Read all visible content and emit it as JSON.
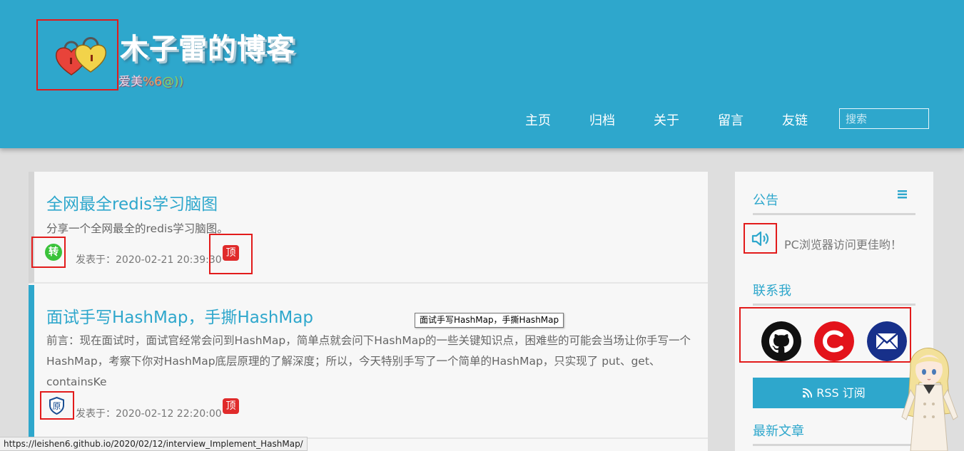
{
  "header": {
    "title": "木子雷的博客",
    "subtitle_part1": "爱美",
    "subtitle_part2": "%6",
    "subtitle_part3": "@))",
    "logo_icon": "heart-locks-icon",
    "nav": [
      {
        "label": "主页"
      },
      {
        "label": "归档"
      },
      {
        "label": "关于"
      },
      {
        "label": "留言"
      },
      {
        "label": "友链"
      }
    ],
    "search_placeholder": "搜索",
    "bg_color": "#2ea7cc"
  },
  "posts": [
    {
      "title": "全网最全redis学习脑图",
      "excerpt": "分享一个全网最全的redis学习脑图。",
      "type_badge": "转",
      "date": "发表于：2020-02-21 20:39:30",
      "top_badge": "顶"
    },
    {
      "title": "面试手写HashMap，手撕HashMap",
      "excerpt": "前言：现在面试时，面试官经常会问到HashMap，简单点就会问下HashMap的一些关键知识点，困难些的可能会当场让你手写一个HashMap，考察下你对HashMap底层原理的了解深度；所以，今天特别手写了一个简单的HashMap，只实现了 put、get、containsKe",
      "type_badge": "原",
      "date": "发表于：2020-02-12 22:20:00",
      "top_badge": "顶"
    }
  ],
  "tooltip": "面试手写HashMap，手撕HashMap",
  "sidebar": {
    "notice_heading": "公告",
    "notice_text": "PC浏览器访问更佳哟！",
    "contact_heading": "联系我",
    "social_icons": [
      "github-icon",
      "csdn-icon",
      "email-icon"
    ],
    "rss_label": "RSS 订阅",
    "latest_heading": "最新文章"
  },
  "status_bar": "https://leishen6.github.io/2020/02/12/interview_Implement_HashMap/",
  "colors": {
    "accent": "#2ea7cc",
    "highlight_box": "#e21b1b",
    "top_badge": "#e02b2b",
    "repost_badge": "#3ac23a"
  }
}
